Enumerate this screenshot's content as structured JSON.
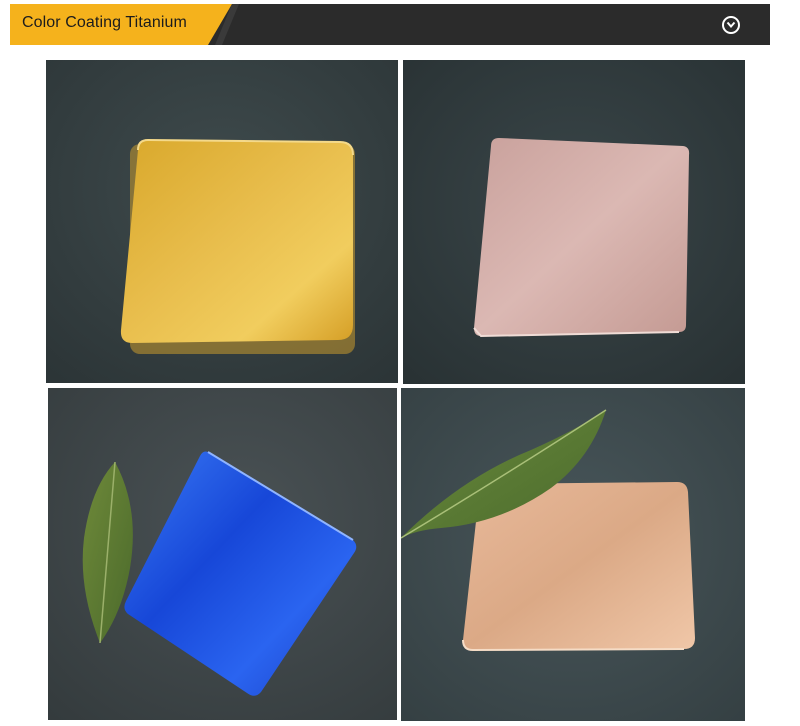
{
  "header": {
    "title": "Color Coating Titanium",
    "toggle_icon": "chevron-down-circle-icon",
    "accent_color": "#f5b21c",
    "bar_color": "#2b2b2b"
  },
  "gallery": {
    "photos": [
      {
        "name": "gold-sheet-photo",
        "sheet_color": "#e2b445",
        "has_leaf": false
      },
      {
        "name": "rose-sheet-photo",
        "sheet_color": "#d2aaa6",
        "has_leaf": false
      },
      {
        "name": "blue-sheet-photo",
        "sheet_color": "#1f57e6",
        "has_leaf": true
      },
      {
        "name": "champagne-sheet-photo",
        "sheet_color": "#e6b493",
        "has_leaf": true
      }
    ]
  }
}
